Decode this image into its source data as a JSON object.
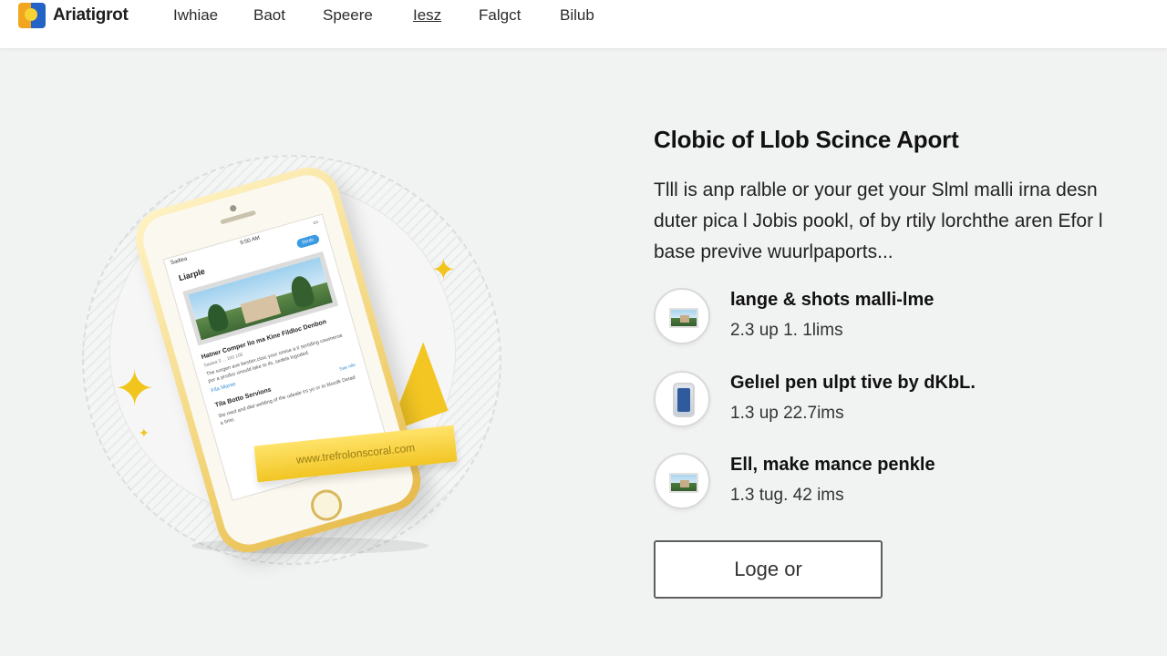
{
  "nav": {
    "brand": "Ariatigrot",
    "links": [
      "Iwhiae",
      "Baot",
      "Speere",
      "Iesz",
      "Falgct",
      "Bilub"
    ]
  },
  "phone": {
    "status_time": "9:50 AM",
    "carrier": "Sadiea",
    "screen_title": "Liarple",
    "pill": "Sirrdo",
    "article_title": "Hatner Comper lio ma Kine Fildloc Denbon",
    "article_meta": "Sasiea 3 ...  100 100",
    "article_body": "The sorgen ave besber.cloic your omise a ti sertiding cawmeroe por a produc unould lake to ils, sedels logoded.",
    "article_link": "Fila Marse",
    "section_title": "Tila Botto Servions",
    "section_more": "Sae rille",
    "section_body": "Ste med and dlal welding of the udeale trs yo or to blocdk Detad a time.",
    "ribbon_text": "www.trefrolonscoral.com"
  },
  "main": {
    "headline": "Clobic of Llob Scince Aport",
    "lede": "Tlll is anp ralble or your get your Slml malli irna desn duter pica l Jobis pookl, of by rtily lorchthe aren Efor l base previve wuurlpaports...",
    "features": [
      {
        "title": "lange & shots malli-lme",
        "subtitle": "2.3 up 1. 1lims",
        "icon": "photo-icon"
      },
      {
        "title": "Gelıel pen ulpt tive by dKbL.",
        "subtitle": "1.3 up 22.7ims",
        "icon": "device-icon"
      },
      {
        "title": "Ell, make mance penkle",
        "subtitle": "1.3 tug. 42 ims",
        "icon": "photo-icon"
      }
    ],
    "cta_label": "Loge or"
  },
  "colors": {
    "accent_yellow": "#f2c51c",
    "logo_blue": "#2363c8",
    "logo_orange": "#f2a51e",
    "background": "#f1f2f2"
  }
}
